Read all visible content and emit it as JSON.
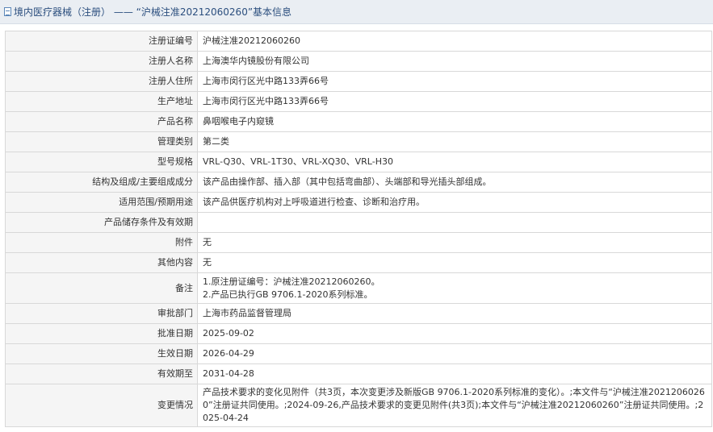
{
  "header": {
    "title": "境内医疗器械（注册） —— “沪械注准20212060260”基本信息"
  },
  "rows": [
    {
      "label": "注册证编号",
      "value": "沪械注准20212060260"
    },
    {
      "label": "注册人名称",
      "value": "上海澳华内镜股份有限公司"
    },
    {
      "label": "注册人住所",
      "value": "上海市闵行区光中路133弄66号"
    },
    {
      "label": "生产地址",
      "value": "上海市闵行区光中路133弄66号"
    },
    {
      "label": "产品名称",
      "value": "鼻咽喉电子内窥镜"
    },
    {
      "label": "管理类别",
      "value": "第二类"
    },
    {
      "label": "型号规格",
      "value": "VRL-Q30、VRL-1T30、VRL-XQ30、VRL-H30"
    },
    {
      "label": "结构及组成/主要组成成分",
      "value": "该产品由操作部、插入部（其中包括弯曲部）、头端部和导光插头部组成。"
    },
    {
      "label": "适用范围/预期用途",
      "value": "该产品供医疗机构对上呼吸道进行检查、诊断和治疗用。"
    },
    {
      "label": "产品储存条件及有效期",
      "value": ""
    },
    {
      "label": "附件",
      "value": "无"
    },
    {
      "label": "其他内容",
      "value": "无"
    },
    {
      "label": "备注",
      "value_lines": [
        "1.原注册证编号：沪械注准20212060260。",
        "2.产品已执行GB 9706.1-2020系列标准。"
      ]
    },
    {
      "label": "审批部门",
      "value": "上海市药品监督管理局"
    },
    {
      "label": "批准日期",
      "value": "2025-09-02"
    },
    {
      "label": "生效日期",
      "value": "2026-04-29"
    },
    {
      "label": "有效期至",
      "value": "2031-04-28"
    },
    {
      "label": "变更情况",
      "value": "产品技术要求的变化见附件（共3页，本次变更涉及新版GB 9706.1-2020系列标准的变化）。;本文件与“沪械注准20212060260”注册证共同使用。;2024-09-26,产品技术要求的变更见附件(共3页);本文件与“沪械注准20212060260”注册证共同使用。;2025-04-24"
    }
  ]
}
